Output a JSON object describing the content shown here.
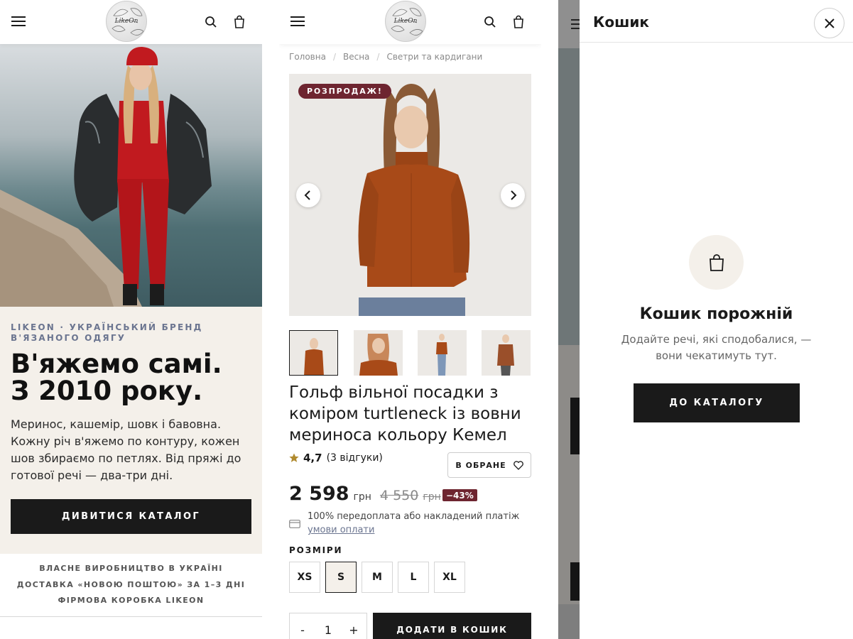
{
  "home": {
    "logo_text": "LikeOn",
    "brand_line": "LIKEON · УКРАЇНСЬКИЙ БРЕНД В'ЯЗАНОГО ОДЯГУ",
    "headline_1": "В'яжемо самі.",
    "headline_2": "З 2010 року.",
    "lead": "Меринос, кашемір, шовк і бавовна. Кожну річ в'яжемо по контуру, кожен шов збираємо по петлях. Від пряжі до готової речі — два-три дні.",
    "cta": "ДИВИТИСЯ КАТАЛОГ",
    "usps": [
      "ВЛАСНЕ ВИРОБНИЦТВО В УКРАЇНІ",
      "ДОСТАВКА «НОВОЮ ПОШТОЮ» ЗА 1–3 ДНІ",
      "ФІРМОВА КОРОБКА LIKEON"
    ]
  },
  "product": {
    "breadcrumbs": [
      "Головна",
      "Весна",
      "Светри та кардигани"
    ],
    "sale_badge": "РОЗПРОДАЖ!",
    "title": "Гольф вільної посадки з коміром turtleneck із вовни мериноса кольору Кемел",
    "rating_value": "4,7",
    "reviews": "(3 відгуки)",
    "fav_label": "В ОБРАНЕ",
    "price": "2 598",
    "currency": "грн",
    "old_price": "4 550",
    "discount": "−43%",
    "payment_note": "100% передоплата або накладений платіж",
    "payment_link": "умови оплати",
    "sizes_label": "РОЗМІРИ",
    "sizes": [
      "XS",
      "S",
      "M",
      "L",
      "XL"
    ],
    "selected_size": "S",
    "qty_minus": "-",
    "qty": "1",
    "qty_plus": "+",
    "add_to_cart": "ДОДАТИ В КОШИК"
  },
  "cart": {
    "title": "Кошик",
    "empty_title": "Кошик порожній",
    "empty_desc": "Додайте речі, які сподобалися, — вони чекатимуть тут.",
    "cta": "ДО КАТАЛОГУ"
  },
  "colors": {
    "dark": "#1a1a1a",
    "beige": "#f4f0ea",
    "sale": "#6e2530",
    "brand_slate": "#6b7590"
  },
  "icons": [
    "menu-icon",
    "search-icon",
    "bag-icon",
    "chevron-left-icon",
    "chevron-right-icon",
    "heart-icon",
    "star-icon",
    "card-icon",
    "close-icon"
  ]
}
